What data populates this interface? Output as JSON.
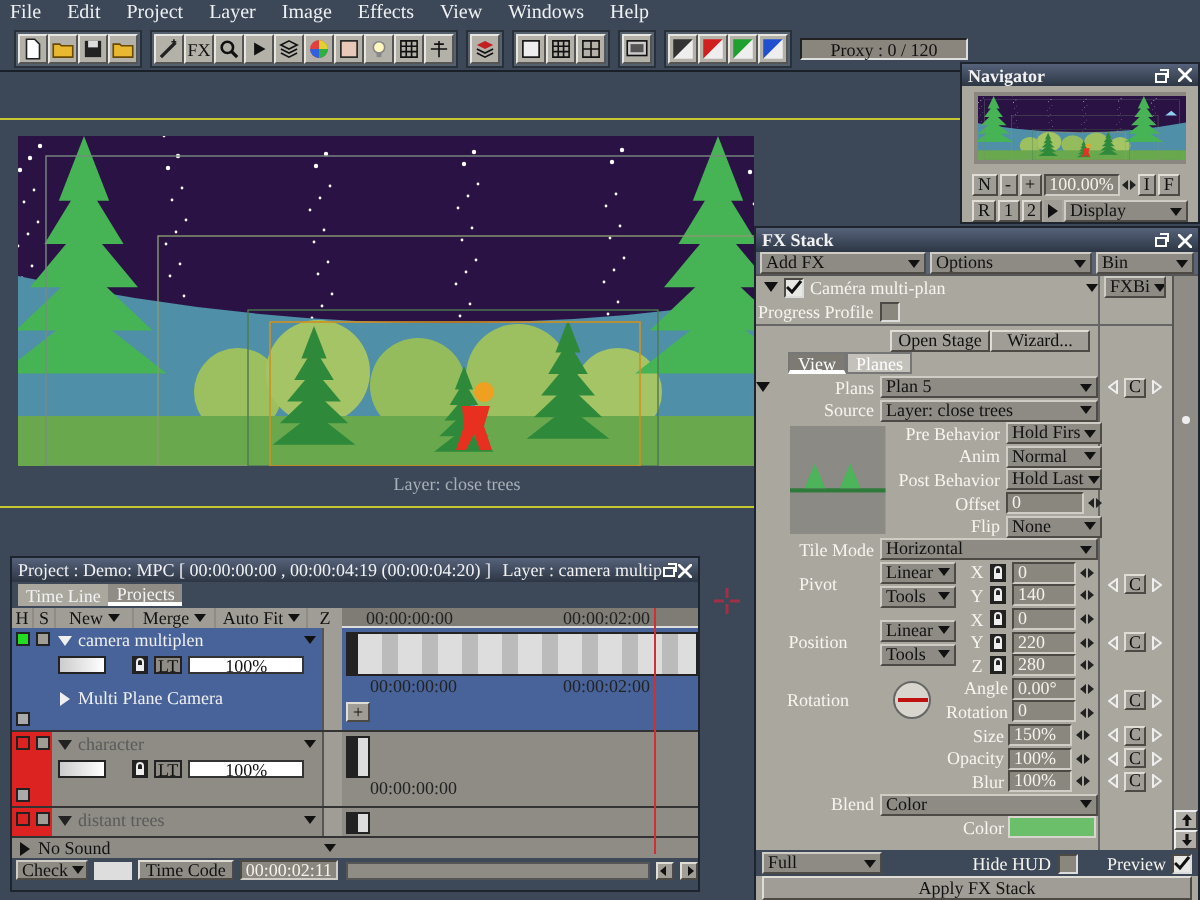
{
  "menu": [
    "File",
    "Edit",
    "Project",
    "Layer",
    "Image",
    "Effects",
    "View",
    "Windows",
    "Help"
  ],
  "toolbar": {
    "fx_label": "FX",
    "proxy": "Proxy : 0 / 120"
  },
  "canvas": {
    "layer_label": "Layer: close trees"
  },
  "navigator": {
    "title": "Navigator",
    "zoom_buttons": [
      "N",
      "-",
      "+"
    ],
    "zoom": "100.00%",
    "fit_buttons": [
      "I",
      "F"
    ],
    "view_buttons": [
      "R",
      "1",
      "2"
    ],
    "display": "Display"
  },
  "fx_stack": {
    "title": "FX Stack",
    "toolbar": [
      "Add FX",
      "Options",
      "Bin"
    ],
    "effect": {
      "name": "Caméra multi-plan",
      "checked": true,
      "expanded": true,
      "bin": "FXBi"
    },
    "progress_profile": {
      "label": "Progress Profile",
      "checked": false
    },
    "buttons": [
      "Open Stage",
      "Wizard..."
    ],
    "tabs": [
      {
        "label": "View",
        "selected": true
      },
      {
        "label": "Planes",
        "selected": false
      }
    ],
    "properties": [
      {
        "kind": "select",
        "label": "Plans",
        "value": "Plan 5",
        "key": "C",
        "expanded": true
      },
      {
        "kind": "select",
        "label": "Source",
        "value": "Layer: close trees"
      },
      {
        "kind": "thumb_group",
        "rows": [
          {
            "kind": "select",
            "label": "Pre Behavior",
            "value": "Hold Firs"
          },
          {
            "kind": "select",
            "label": "Anim",
            "value": "Normal"
          },
          {
            "kind": "select",
            "label": "Post Behavior",
            "value": "Hold Last"
          },
          {
            "kind": "field",
            "label": "Offset",
            "value": "0"
          },
          {
            "kind": "select",
            "label": "Flip",
            "value": "None"
          }
        ]
      },
      {
        "kind": "select",
        "label": "Tile Mode",
        "value": "Horizontal"
      },
      {
        "kind": "vector",
        "label": "Pivot",
        "modes": [
          "Linear",
          "Tools"
        ],
        "fields": [
          {
            "axis": "X",
            "value": "0"
          },
          {
            "axis": "Y",
            "value": "140"
          }
        ],
        "key": "C"
      },
      {
        "kind": "vector",
        "label": "Position",
        "modes": [
          "Linear",
          "Tools"
        ],
        "fields": [
          {
            "axis": "X",
            "value": "0"
          },
          {
            "axis": "Y",
            "value": "220"
          },
          {
            "axis": "Z",
            "value": "280"
          }
        ],
        "key": "C"
      },
      {
        "kind": "dial",
        "label": "Rotation",
        "fields": [
          {
            "label": "Angle",
            "value": "0.00°"
          },
          {
            "label": "Rotation",
            "value": "0"
          }
        ],
        "key": "C"
      },
      {
        "kind": "field",
        "label": "Size",
        "value": "150%",
        "key": "C"
      },
      {
        "kind": "field",
        "label": "Opacity",
        "value": "100%",
        "key": "C"
      },
      {
        "kind": "field",
        "label": "Blur",
        "value": "100%",
        "key": "C"
      },
      {
        "kind": "select",
        "label": "Blend",
        "value": "Color"
      },
      {
        "kind": "color",
        "label": "Color",
        "color": "#6cbf6a"
      }
    ],
    "footer": {
      "quality": "Full",
      "hide_hud": {
        "label": "Hide HUD",
        "checked": false
      },
      "preview": {
        "label": "Preview",
        "checked": true
      },
      "apply": "Apply FX Stack"
    }
  },
  "project": {
    "title": "Project : Demo: MPC [ 00:00:00:00 , 00:00:04:19  (00:00:04:20) ]",
    "layer_title": "Layer : camera multip",
    "tabs": [
      {
        "label": "Time Line",
        "selected": false
      },
      {
        "label": "Projects",
        "selected": true
      }
    ],
    "columns": [
      "H",
      "S",
      "New",
      "Merge",
      "Auto Fit",
      "Z"
    ],
    "ruler": [
      "00:00:00:00",
      "00:00:02:00"
    ],
    "layers": [
      {
        "name": "camera multiplen",
        "color": "#22dd22",
        "selected": true,
        "expanded": true,
        "blend": "LT",
        "opacity": "100%",
        "children": [
          {
            "name": "Multi Plane Camera",
            "expanded": false
          }
        ],
        "add_button": "+",
        "track_labels": [
          "00:00:00:00",
          "00:00:02:00"
        ]
      },
      {
        "name": "character",
        "color": "#dd2222",
        "selected": false,
        "expanded": true,
        "blend": "LT",
        "opacity": "100%",
        "track_labels": [
          "00:00:00:00"
        ]
      },
      {
        "name": "distant trees",
        "color": "#dd2222",
        "selected": false,
        "expanded": true
      }
    ],
    "sound": {
      "label": "No Sound",
      "expanded": false
    },
    "footer": {
      "check": "Check",
      "time_code_label": "Time Code",
      "time_code": "00:00:02:11"
    }
  }
}
